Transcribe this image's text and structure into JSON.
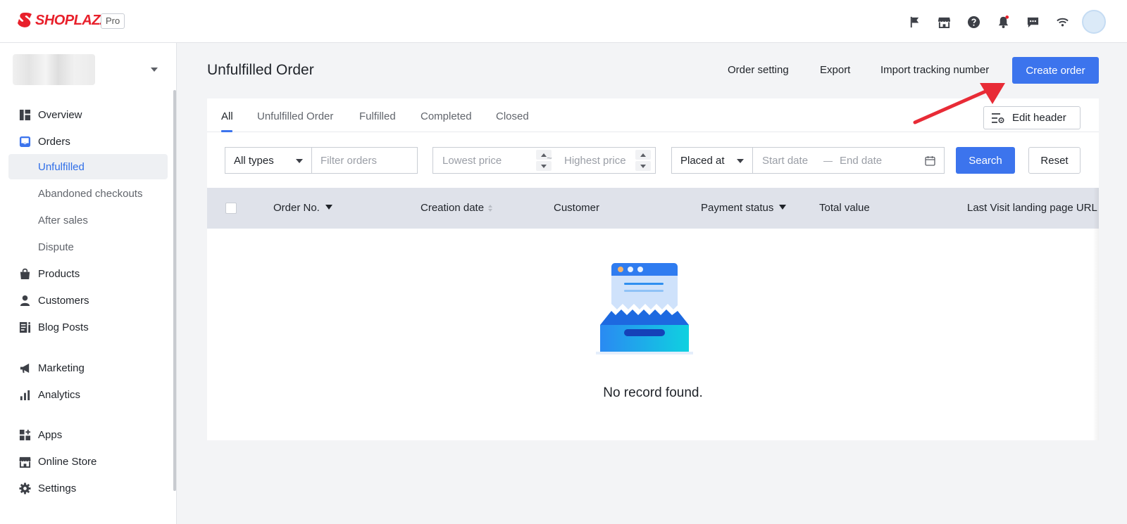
{
  "brand": {
    "logo_text": "SHOPLAZZA",
    "plan": "Pro",
    "accent": "#3c74ed",
    "logo_color": "#e8202b"
  },
  "topbar": {
    "icons": [
      "flag-icon",
      "store-icon",
      "help-icon",
      "notification-bell-icon",
      "message-icon",
      "wifi-icon"
    ],
    "notification_dot_color": "#e8202b"
  },
  "sidebar": {
    "nav": [
      {
        "label": "Overview",
        "icon": "overview-icon"
      },
      {
        "label": "Orders",
        "icon": "orders-inbox-icon"
      },
      {
        "label": "Unfulfilled",
        "sub": true,
        "active": true
      },
      {
        "label": "Abandoned checkouts",
        "sub": true
      },
      {
        "label": "After sales",
        "sub": true
      },
      {
        "label": "Dispute",
        "sub": true
      },
      {
        "label": "Products",
        "icon": "shopping-bag-icon"
      },
      {
        "label": "Customers",
        "icon": "person-icon"
      },
      {
        "label": "Blog Posts",
        "icon": "blog-icon"
      },
      {
        "label": "Marketing",
        "icon": "megaphone-icon"
      },
      {
        "label": "Analytics",
        "icon": "bar-chart-icon"
      },
      {
        "label": "Apps",
        "icon": "apps-icon"
      },
      {
        "label": "Online Store",
        "icon": "storefront-icon"
      },
      {
        "label": "Settings",
        "icon": "gear-icon"
      }
    ]
  },
  "page": {
    "title": "Unfulfilled Order",
    "actions": {
      "order_setting": "Order setting",
      "export": "Export",
      "import_tracking": "Import tracking number",
      "create_order": "Create order"
    }
  },
  "tabs": [
    "All",
    "Unfulfilled Order",
    "Fulfilled",
    "Completed",
    "Closed"
  ],
  "active_tab": "All",
  "edit_header": "Edit header",
  "filters": {
    "type_select": "All types",
    "filter_placeholder": "Filter orders",
    "lowest_price_placeholder": "Lowest price",
    "range_separator": "~",
    "highest_price_placeholder": "Highest price",
    "date_type_select": "Placed at",
    "start_date_placeholder": "Start date",
    "date_separator": "—",
    "end_date_placeholder": "End date",
    "search_button": "Search",
    "reset_button": "Reset"
  },
  "table": {
    "columns": [
      "Order No.",
      "Creation date",
      "Customer",
      "Payment status",
      "Total value",
      "Last Visit landing page URL"
    ],
    "rows": []
  },
  "empty_state": {
    "message": "No record found."
  }
}
